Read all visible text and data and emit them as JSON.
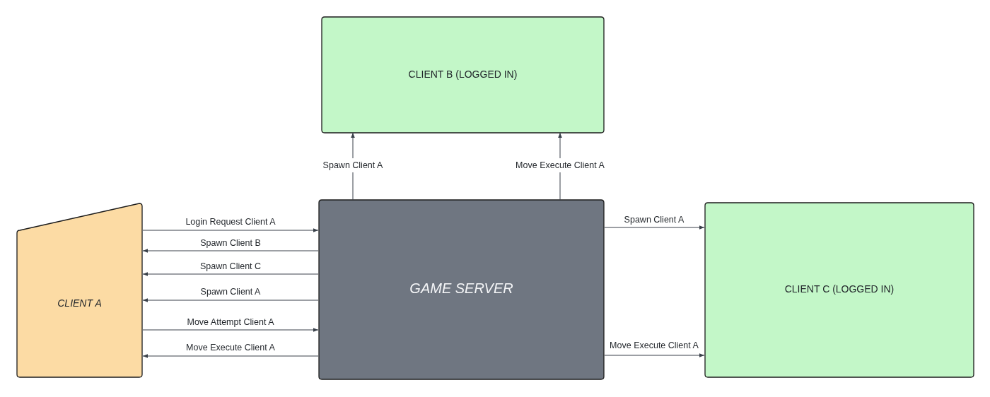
{
  "nodes": [
    {
      "label": "CLIENT B (LOGGED IN)",
      "kind": "client",
      "color": "#c3f7c8"
    },
    {
      "label": "CLIENT A",
      "kind": "manual-input",
      "color": "#fcdba4"
    },
    {
      "label": "GAME SERVER",
      "kind": "server",
      "color": "#6f7681"
    },
    {
      "label": "CLIENT C (LOGGED IN)",
      "kind": "client",
      "color": "#c3f7c8"
    }
  ],
  "arrows": [
    {
      "label": "Login Request Client A",
      "kind": "rightward"
    },
    {
      "label": "Spawn Client B",
      "kind": "leftward"
    },
    {
      "label": "Spawn Client C",
      "kind": "leftward"
    },
    {
      "label": "Spawn Client A",
      "kind": "leftward"
    },
    {
      "label": "Move Attempt Client A",
      "kind": "rightward"
    },
    {
      "label": "Move Execute Client A",
      "kind": "leftward"
    },
    {
      "label": "Spawn Client A",
      "kind": "upward"
    },
    {
      "label": "Move Execute Client A",
      "kind": "upward"
    },
    {
      "label": "Spawn Client A",
      "kind": "rightward"
    },
    {
      "label": "Move Execute Client A",
      "kind": "rightward"
    }
  ]
}
